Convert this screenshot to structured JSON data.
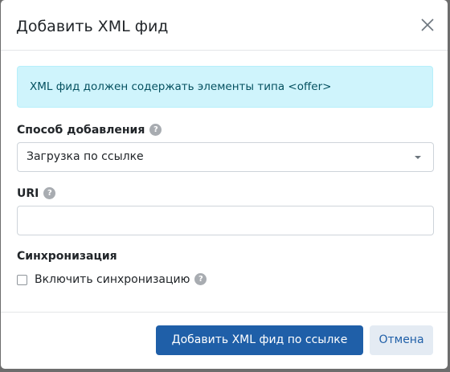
{
  "modal": {
    "title": "Добавить XML фид",
    "close_icon": "close-icon"
  },
  "alert": {
    "text": "XML фид должен содержать элементы типа <offer>"
  },
  "fields": {
    "method": {
      "label": "Способ добавления",
      "help_glyph": "?",
      "selected_value": "Загрузка по ссылке"
    },
    "uri": {
      "label": "URI",
      "help_glyph": "?",
      "value": "",
      "placeholder": ""
    },
    "sync": {
      "label": "Синхронизация",
      "checkbox_label": "Включить синхронизацию",
      "help_glyph": "?",
      "checked": false
    }
  },
  "footer": {
    "submit_label": "Добавить XML фид по ссылке",
    "cancel_label": "Отмена"
  },
  "colors": {
    "primary": "#1f5fa8",
    "alert_background": "#cff4fc",
    "alert_text": "#055160",
    "secondary_background": "#e4ebf3"
  }
}
